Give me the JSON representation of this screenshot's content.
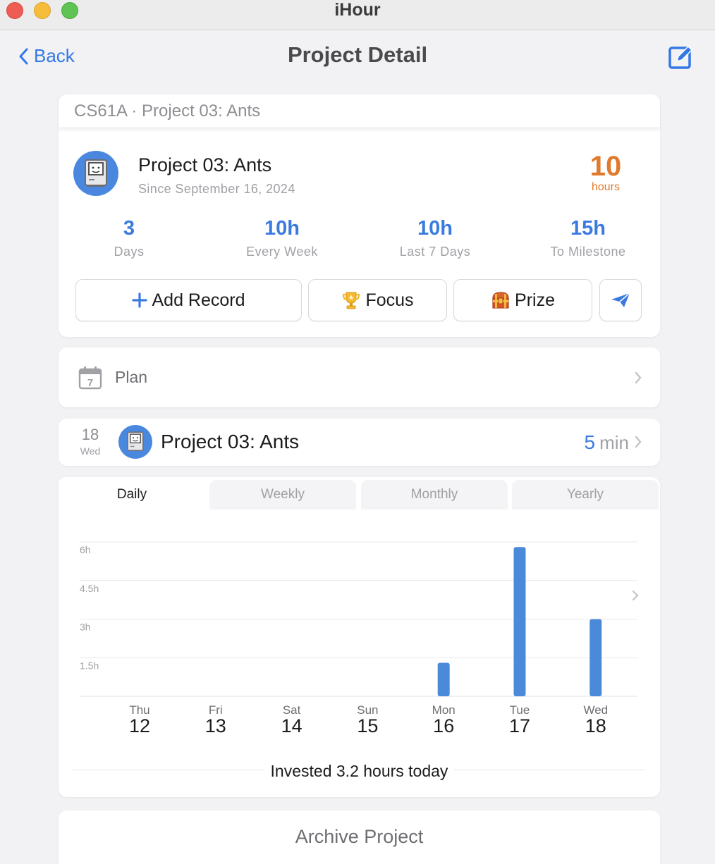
{
  "window": {
    "title": "iHour"
  },
  "nav": {
    "back_label": "Back",
    "title": "Project Detail",
    "edit_icon": "square-pencil-icon"
  },
  "project": {
    "category": "CS61A · Project 03: Ants",
    "name": "Project 03: Ants",
    "since": "Since September 16, 2024",
    "hours_total": "10",
    "hours_label": "hours",
    "accent_color": "#e07a2c",
    "icon": "classic-mac-icon"
  },
  "stats": [
    {
      "value": "3",
      "label": "Days"
    },
    {
      "value": "10h",
      "label": "Every Week"
    },
    {
      "value": "10h",
      "label": "Last 7 Days"
    },
    {
      "value": "15h",
      "label": "To Milestone"
    }
  ],
  "actions": {
    "add_record": "Add Record",
    "focus": "Focus",
    "prize": "Prize",
    "share_icon": "paper-plane-icon"
  },
  "plan": {
    "label": "Plan",
    "icon_day": "7"
  },
  "record": {
    "day": "18",
    "weekday": "Wed",
    "name": "Project 03: Ants",
    "duration_value": "5",
    "duration_unit": "min"
  },
  "tabs": [
    "Daily",
    "Weekly",
    "Monthly",
    "Yearly"
  ],
  "active_tab": "Daily",
  "chart_data": {
    "type": "bar",
    "categories": [
      {
        "weekday": "Thu",
        "day": "12"
      },
      {
        "weekday": "Fri",
        "day": "13"
      },
      {
        "weekday": "Sat",
        "day": "14"
      },
      {
        "weekday": "Sun",
        "day": "15"
      },
      {
        "weekday": "Mon",
        "day": "16"
      },
      {
        "weekday": "Tue",
        "day": "17"
      },
      {
        "weekday": "Wed",
        "day": "18"
      }
    ],
    "values": [
      0,
      0,
      0,
      0,
      1.3,
      5.8,
      3.0
    ],
    "yticks": [
      "1.5h",
      "3h",
      "4.5h",
      "6h"
    ],
    "ytick_values": [
      1.5,
      3,
      4.5,
      6
    ],
    "ylim": [
      0,
      6
    ],
    "bar_color": "#4a8ad8",
    "grid": true
  },
  "invested_text": "Invested 3.2 hours today",
  "archive_label": "Archive Project"
}
